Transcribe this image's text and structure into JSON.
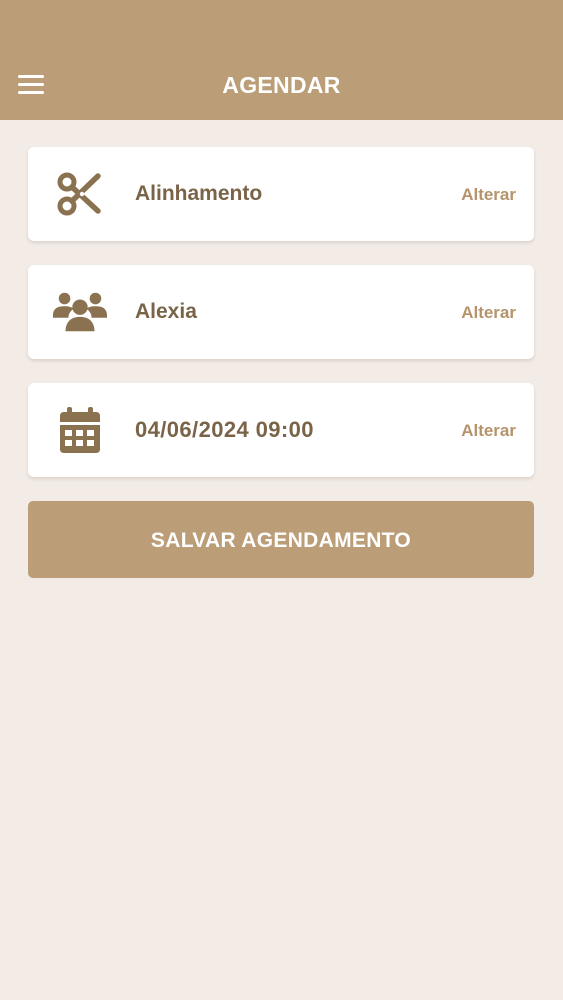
{
  "header": {
    "title": "AGENDAR",
    "menu_icon": "hamburger-menu-icon"
  },
  "items": [
    {
      "icon": "scissors-icon",
      "label": "Alinhamento",
      "action": "Alterar"
    },
    {
      "icon": "users-icon",
      "label": "Alexia",
      "action": "Alterar"
    },
    {
      "icon": "calendar-icon",
      "label": "04/06/2024 09:00",
      "action": "Alterar"
    }
  ],
  "save_button": {
    "label": "SALVAR AGENDAMENTO"
  },
  "colors": {
    "brand": "#bb9e78",
    "background": "#f2ebe6",
    "label_text": "#7a6448",
    "action_text": "#b5946b",
    "icon": "#8a7250"
  }
}
